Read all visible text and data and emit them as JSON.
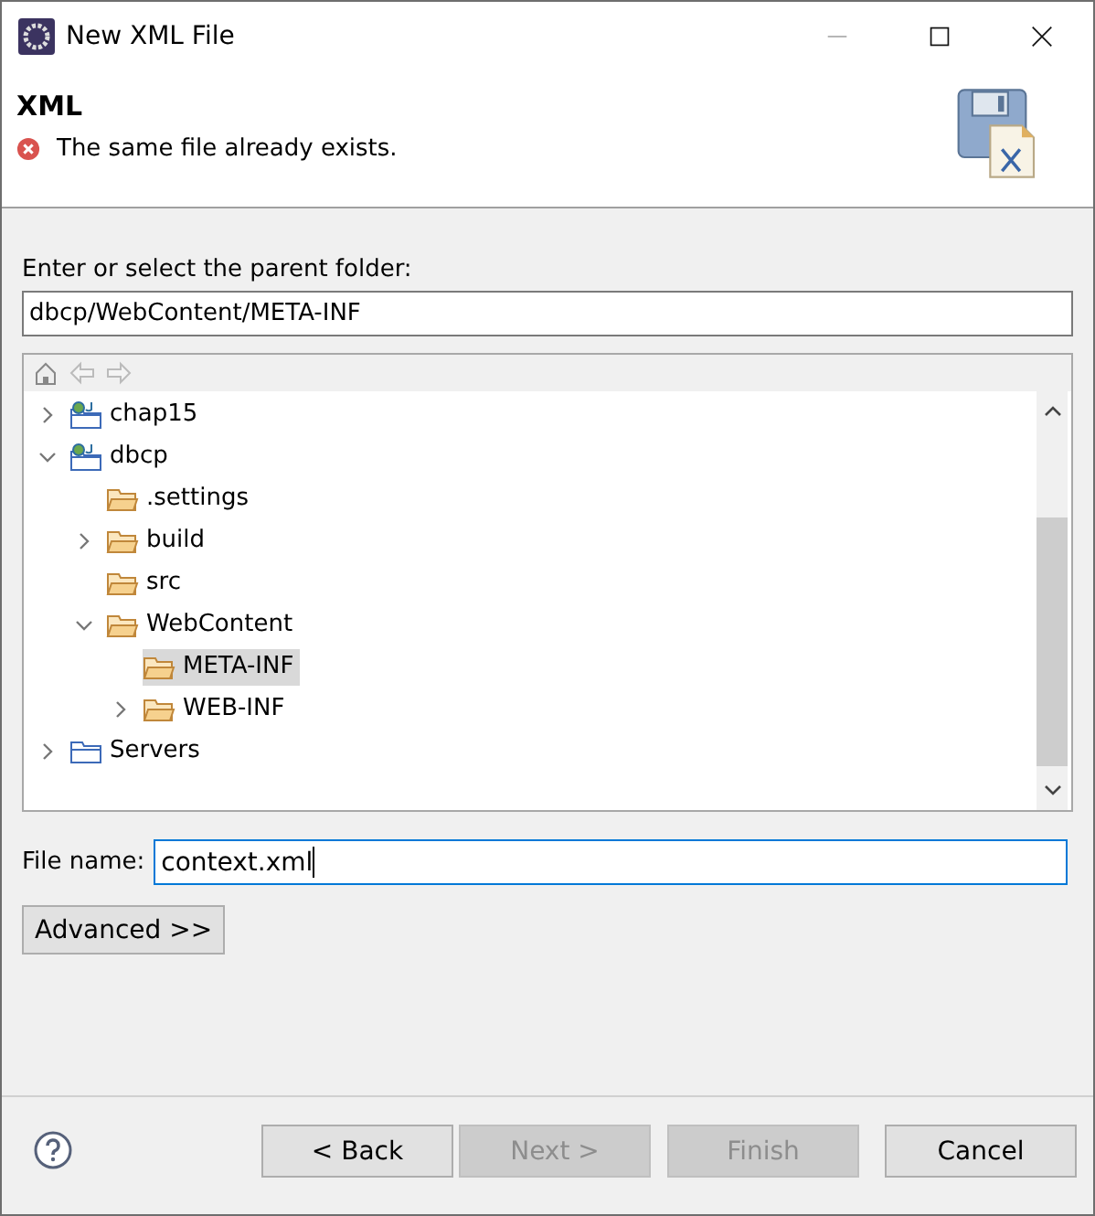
{
  "window": {
    "title": "New XML File"
  },
  "header": {
    "title": "XML",
    "message": "The same file already exists."
  },
  "folder_label": {
    "text": "Enter or select the parent folder:"
  },
  "folder_path": {
    "value": "dbcp/WebContent/META-INF"
  },
  "tree": [
    {
      "label": "chap15",
      "kind": "project",
      "expanded": false,
      "selected": false
    },
    {
      "label": "dbcp",
      "kind": "project",
      "expanded": true,
      "selected": false,
      "children": [
        {
          "label": ".settings",
          "kind": "folder",
          "selected": false
        },
        {
          "label": "build",
          "kind": "folder",
          "expanded": false,
          "selected": false
        },
        {
          "label": "src",
          "kind": "folder",
          "selected": false
        },
        {
          "label": "WebContent",
          "kind": "folder",
          "expanded": true,
          "selected": false,
          "children": [
            {
              "label": "META-INF",
              "kind": "folder",
              "selected": true
            },
            {
              "label": "WEB-INF",
              "kind": "folder",
              "expanded": false,
              "selected": false
            }
          ]
        }
      ]
    },
    {
      "label": "Servers",
      "kind": "project_folder",
      "expanded": false,
      "selected": false
    }
  ],
  "file_name": {
    "label": "File name:",
    "value": "context.xml"
  },
  "advanced_button": {
    "label": "Advanced >>"
  },
  "buttons": [
    {
      "label": "< Back",
      "disabled": false
    },
    {
      "label": "Next >",
      "disabled": true
    },
    {
      "label": "Finish",
      "disabled": true
    },
    {
      "label": "Cancel",
      "disabled": false
    }
  ]
}
